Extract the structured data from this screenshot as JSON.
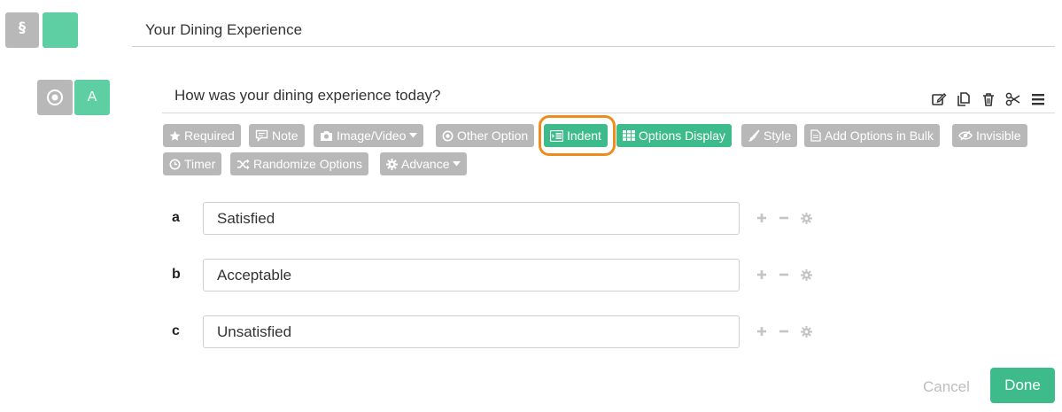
{
  "section": {
    "badge_symbol": "§",
    "title": "Your Dining Experience",
    "color": "#5dcfa3"
  },
  "question": {
    "label": "A",
    "type_icon": "radio-icon",
    "text": "How was your dining experience today?",
    "tools": [
      "edit-icon",
      "copy-icon",
      "trash-icon",
      "scissors-icon",
      "menu-icon"
    ]
  },
  "toolbar": {
    "required": "Required",
    "note": "Note",
    "image_video": "Image/Video",
    "other_option": "Other Option",
    "indent": "Indent",
    "options_display": "Options Display",
    "style": "Style",
    "add_options_bulk": "Add Options in Bulk",
    "invisible": "Invisible",
    "timer": "Timer",
    "randomize": "Randomize Options",
    "advance": "Advance",
    "active_color": "#3dbb8a",
    "inactive_color": "#b8b8b8",
    "highlight_color": "#ee8d1e"
  },
  "options": [
    {
      "letter": "a",
      "value": "Satisfied"
    },
    {
      "letter": "b",
      "value": "Acceptable"
    },
    {
      "letter": "c",
      "value": "Unsatisfied"
    }
  ],
  "footer": {
    "cancel": "Cancel",
    "done": "Done"
  }
}
